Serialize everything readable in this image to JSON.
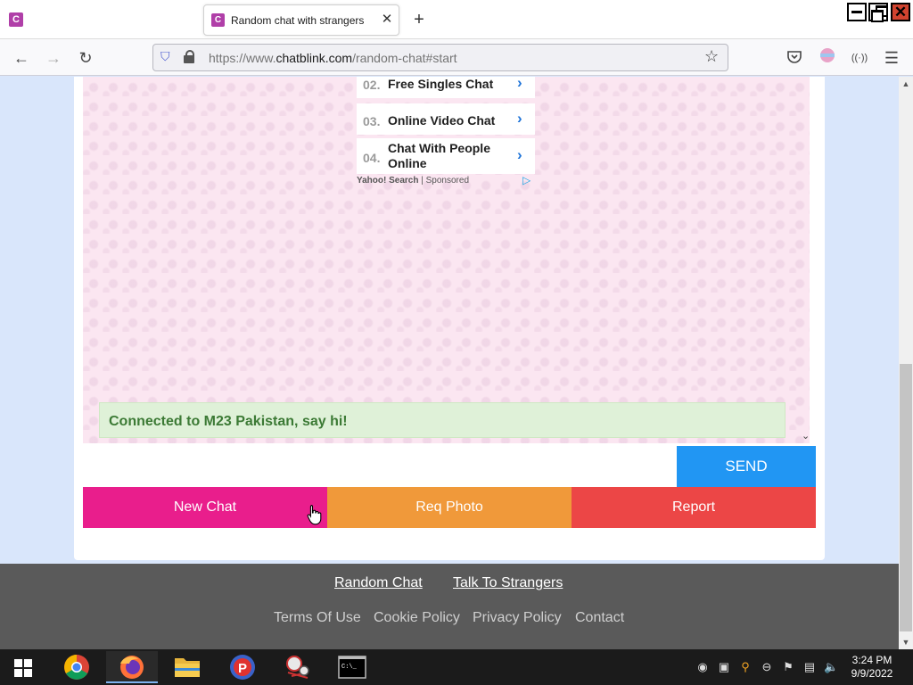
{
  "browser": {
    "tab_title": "Random chat with strangers",
    "favicon_letter": "C",
    "url_prefix": "https://www.",
    "url_domain": "chatblink.com",
    "url_path": "/random-chat#start"
  },
  "ad": {
    "items": [
      {
        "num": "02.",
        "label": "Free Singles Chat"
      },
      {
        "num": "03.",
        "label": "Online Video Chat"
      },
      {
        "num": "04.",
        "label": "Chat With People Online"
      }
    ],
    "provider": "Yahoo! Search",
    "separator": "|",
    "sponsored": "Sponsored"
  },
  "chat": {
    "status_message": "Connected to M23 Pakistan, say hi!",
    "input_value": "",
    "send_label": "SEND"
  },
  "actions": {
    "new_chat": "New Chat",
    "req_photo": "Req Photo",
    "report": "Report"
  },
  "footer": {
    "primary_links": [
      "Random Chat",
      "Talk To Strangers"
    ],
    "secondary_links": [
      "Terms Of Use",
      "Cookie Policy",
      "Privacy Policy",
      "Contact"
    ]
  },
  "taskbar": {
    "apps": [
      "chrome-icon",
      "firefox-icon",
      "file-explorer-icon",
      "paint-icon",
      "network-icon",
      "terminal-icon"
    ],
    "time": "3:24 PM",
    "date": "9/9/2022"
  },
  "colors": {
    "send": "#2196f3",
    "new_chat": "#e91e8c",
    "req_photo": "#f0993a",
    "report": "#ec4646",
    "status_bg": "#dff1d8",
    "status_text": "#3c7a35"
  }
}
